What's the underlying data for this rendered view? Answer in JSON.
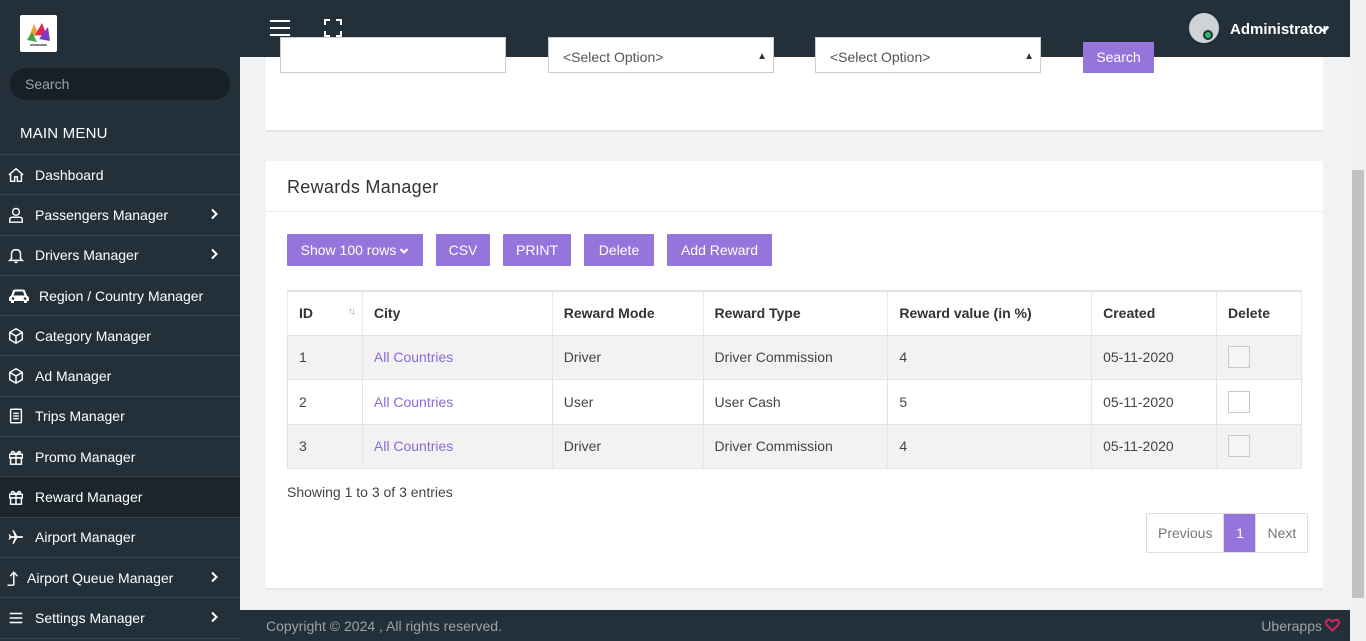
{
  "sidebar": {
    "search_placeholder": "Search",
    "menu_title": "MAIN MENU",
    "items": [
      {
        "label": "Dashboard",
        "icon": "home-icon",
        "chevron": false
      },
      {
        "label": "Passengers Manager",
        "icon": "user-icon",
        "chevron": true
      },
      {
        "label": "Drivers Manager",
        "icon": "bell-icon",
        "chevron": true
      },
      {
        "label": "Region / Country Manager",
        "icon": "car-icon",
        "chevron": false
      },
      {
        "label": "Category Manager",
        "icon": "cube-icon",
        "chevron": false
      },
      {
        "label": "Ad Manager",
        "icon": "cube-icon",
        "chevron": false
      },
      {
        "label": "Trips Manager",
        "icon": "document-icon",
        "chevron": false
      },
      {
        "label": "Promo Manager",
        "icon": "gift-icon",
        "chevron": false
      },
      {
        "label": "Reward Manager",
        "icon": "gift-icon",
        "chevron": false,
        "active": true
      },
      {
        "label": "Airport Manager",
        "icon": "plane-icon",
        "chevron": false
      },
      {
        "label": "Airport Queue Manager",
        "icon": "arrow-up-icon",
        "chevron": true
      },
      {
        "label": "Settings Manager",
        "icon": "menu-icon",
        "chevron": true
      }
    ]
  },
  "topbar": {
    "user_name": "Administrator"
  },
  "filters": {
    "select1": "<Select Option>",
    "select2": "<Select Option>",
    "search_label": "Search"
  },
  "card": {
    "title": "Rewards Manager",
    "buttons": {
      "rows": "Show 100 rows",
      "csv": "CSV",
      "print": "PRINT",
      "delete": "Delete",
      "add": "Add Reward"
    },
    "columns": [
      "ID",
      "City",
      "Reward Mode",
      "Reward Type",
      "Reward value (in %)",
      "Created",
      "Delete"
    ],
    "rows": [
      {
        "id": "1",
        "city": "All Countries",
        "mode": "Driver",
        "type": "Driver Commission",
        "value": "4",
        "created": "05-11-2020"
      },
      {
        "id": "2",
        "city": "All Countries",
        "mode": "User",
        "type": "User Cash",
        "value": "5",
        "created": "05-11-2020"
      },
      {
        "id": "3",
        "city": "All Countries",
        "mode": "Driver",
        "type": "Driver Commission",
        "value": "4",
        "created": "05-11-2020"
      }
    ],
    "showing": "Showing 1 to 3 of 3 entries",
    "pager": {
      "prev": "Previous",
      "current": "1",
      "next": "Next"
    }
  },
  "footer": {
    "copyright": "Copyright © 2024 , All rights reserved.",
    "brand": "Uberapps"
  },
  "colors": {
    "accent": "#9575db",
    "sidebar": "#243039",
    "link": "#8c6ad2"
  }
}
